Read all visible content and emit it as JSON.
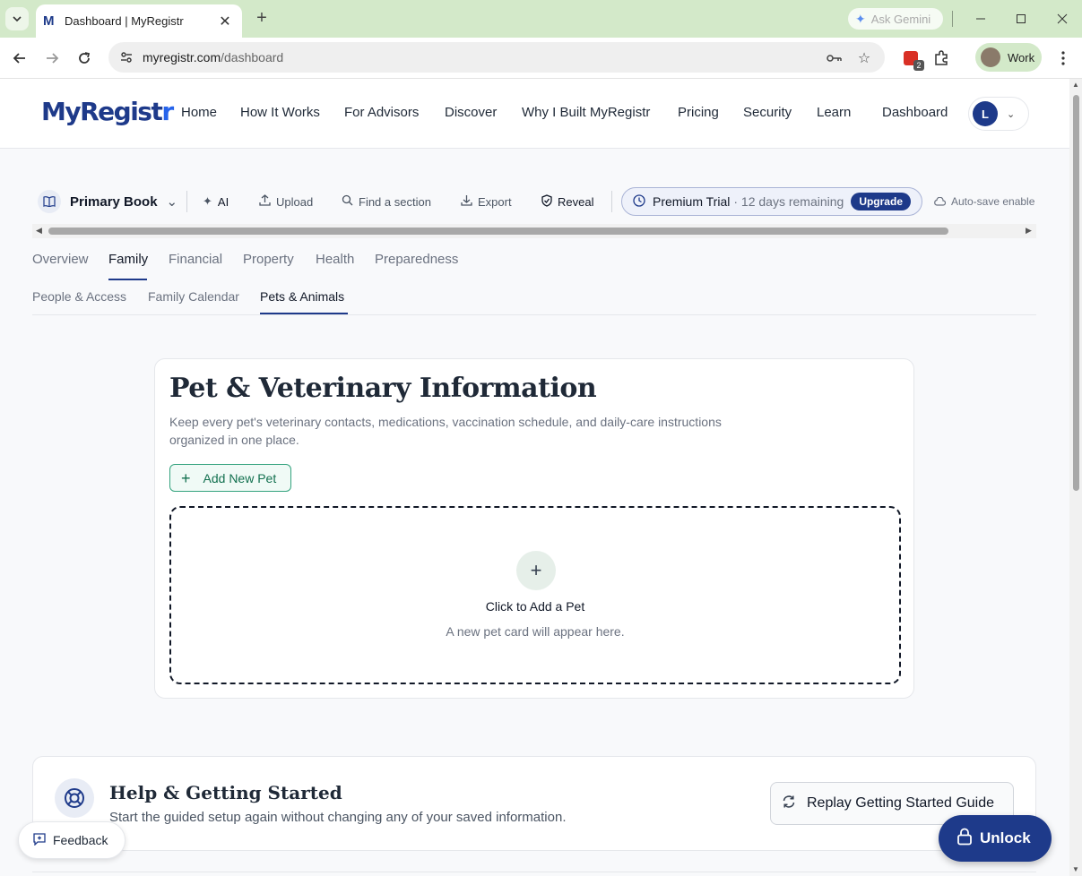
{
  "browser": {
    "tab_title": "Dashboard | MyRegistr",
    "tab_favicon": "M",
    "new_tab": "+",
    "ask_gemini": "Ask Gemini",
    "url_host": "myregistr.com",
    "url_path": "/dashboard",
    "extension_badge": "2",
    "profile_name": "Work"
  },
  "site": {
    "logo_main": "MyRegist",
    "logo_accent": "r",
    "nav": [
      "Home",
      "How It Works",
      "For Advisors",
      "Discover",
      "Why I Built MyRegistr",
      "Pricing",
      "Security",
      "Learn",
      "Dashboard"
    ],
    "avatar_initial": "L"
  },
  "toolbar": {
    "book": "Primary Book",
    "ai": "AI",
    "upload": "Upload",
    "find": "Find a section",
    "export": "Export",
    "reveal": "Reveal",
    "premium_label": "Premium Trial",
    "premium_remaining": "· 12 days remaining",
    "upgrade": "Upgrade",
    "autosave": "Auto-save enable"
  },
  "tabs": {
    "primary": [
      "Overview",
      "Family",
      "Financial",
      "Property",
      "Health",
      "Preparedness"
    ],
    "primary_active": "Family",
    "secondary": [
      "People & Access",
      "Family Calendar",
      "Pets & Animals"
    ],
    "secondary_active": "Pets & Animals"
  },
  "pets": {
    "title": "Pet & Veterinary Information",
    "description": "Keep every pet's veterinary contacts, medications, vaccination schedule, and daily-care instructions organized in one place.",
    "add_button": "Add New Pet",
    "dropzone_title": "Click to Add a Pet",
    "dropzone_sub": "A new pet card will appear here."
  },
  "help": {
    "title": "Help & Getting Started",
    "subtitle": "Start the guided setup again without changing any of your saved information.",
    "replay_button": "Replay Getting Started Guide"
  },
  "floating": {
    "feedback": "Feedback",
    "unlock": "Unlock"
  },
  "colors": {
    "brand": "#1e3a8a",
    "tabbar": "#d3e9c9",
    "add_accent": "#12704f"
  }
}
